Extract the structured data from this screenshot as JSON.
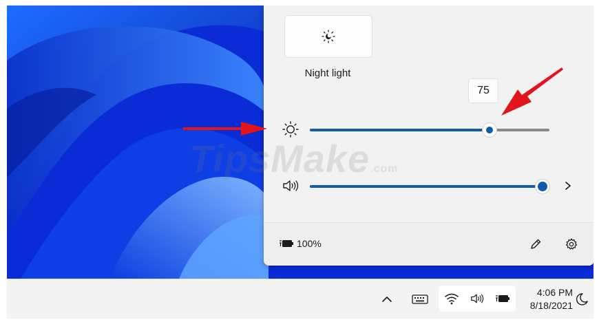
{
  "quick_settings": {
    "night_light": {
      "label": "Night light",
      "icon": "night-light-icon"
    },
    "brightness": {
      "value": 75,
      "tooltip": "75",
      "icon": "brightness-sun-icon"
    },
    "volume": {
      "value": 97,
      "icon": "speaker-icon"
    },
    "battery": {
      "text": "100%",
      "icon": "battery-charging-icon"
    },
    "footer_buttons": [
      "edit-pencil-icon",
      "settings-gear-icon"
    ]
  },
  "taskbar": {
    "icons": [
      "chevron-up-icon",
      "keyboard-icon",
      "wifi-icon",
      "speaker-icon",
      "battery-charging-icon",
      "moon-icon"
    ],
    "clock": {
      "time": "4:06 PM",
      "date": "8/18/2021"
    }
  },
  "watermark": {
    "text": "TipsMake",
    "suffix": ".com"
  },
  "colors": {
    "accent": "#0f5ca8",
    "annotation_arrow": "#e3141b",
    "wallpaper": "#0a2ad9"
  }
}
